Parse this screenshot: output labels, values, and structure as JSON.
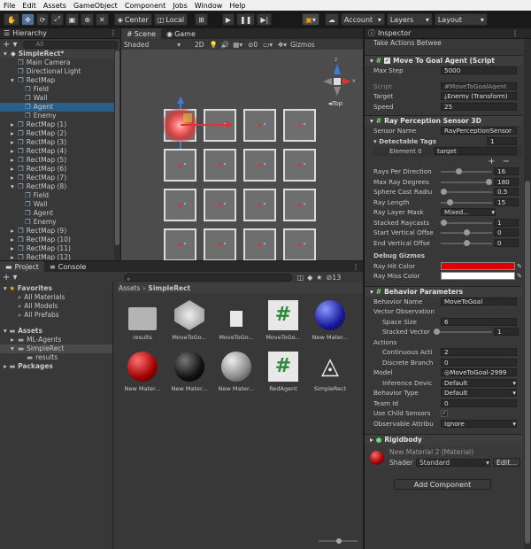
{
  "menu": [
    "File",
    "Edit",
    "Assets",
    "GameObject",
    "Component",
    "Jobs",
    "Window",
    "Help"
  ],
  "toolbar": {
    "center_label": "Center",
    "local_label": "Local",
    "account_label": "Account",
    "layers_label": "Layers",
    "layout_label": "Layout"
  },
  "hierarchy": {
    "tab": "Hierarchy",
    "search_placeholder": "All",
    "items": [
      {
        "label": "SimpleRect*",
        "indent": 0,
        "bold": true
      },
      {
        "label": "Main Camera",
        "indent": 1
      },
      {
        "label": "Directional Light",
        "indent": 1
      },
      {
        "label": "RectMap",
        "indent": 1
      },
      {
        "label": "Field",
        "indent": 2
      },
      {
        "label": "Wall",
        "indent": 2
      },
      {
        "label": "Agent",
        "indent": 2,
        "selected": true
      },
      {
        "label": "Enemy",
        "indent": 2
      },
      {
        "label": "RectMap (1)",
        "indent": 1
      },
      {
        "label": "RectMap (2)",
        "indent": 1
      },
      {
        "label": "RectMap (3)",
        "indent": 1
      },
      {
        "label": "RectMap (4)",
        "indent": 1
      },
      {
        "label": "RectMap (5)",
        "indent": 1
      },
      {
        "label": "RectMap (6)",
        "indent": 1
      },
      {
        "label": "RectMap (7)",
        "indent": 1
      },
      {
        "label": "RectMap (8)",
        "indent": 1
      },
      {
        "label": "Field",
        "indent": 2
      },
      {
        "label": "Wall",
        "indent": 2
      },
      {
        "label": "Agent",
        "indent": 2
      },
      {
        "label": "Enemy",
        "indent": 2
      },
      {
        "label": "RectMap (9)",
        "indent": 1
      },
      {
        "label": "RectMap (10)",
        "indent": 1
      },
      {
        "label": "RectMap (11)",
        "indent": 1
      },
      {
        "label": "RectMap (12)",
        "indent": 1
      }
    ]
  },
  "scene": {
    "tab_scene": "Scene",
    "tab_game": "Game",
    "shading": "Shaded",
    "mode_2d": "2D",
    "gizmos": "Gizmos",
    "gizmo_label": "Top",
    "axis_x": "x",
    "axis_z": "z"
  },
  "project": {
    "tab_project": "Project",
    "tab_console": "Console",
    "hidden_count": "13",
    "breadcrumb_root": "Assets",
    "breadcrumb_leaf": "SimpleRect",
    "favorites_label": "Favorites",
    "favorites": [
      "All Materials",
      "All Models",
      "All Prefabs"
    ],
    "assets_label": "Assets",
    "folders": [
      "ML-Agents",
      "SimpleRect",
      "results"
    ],
    "packages_label": "Packages",
    "assets": [
      {
        "name": "results",
        "kind": "folder"
      },
      {
        "name": "MoveToGo...",
        "kind": "mesh"
      },
      {
        "name": "MoveToGo...",
        "kind": "file"
      },
      {
        "name": "MoveToGo...",
        "kind": "script"
      },
      {
        "name": "New Mater...",
        "kind": "blue"
      },
      {
        "name": "New Mater...",
        "kind": "red"
      },
      {
        "name": "New Mater...",
        "kind": "black"
      },
      {
        "name": "New Mater...",
        "kind": "gray"
      },
      {
        "name": "RedAgent",
        "kind": "script"
      },
      {
        "name": "SimpleRect",
        "kind": "unity"
      }
    ]
  },
  "inspector": {
    "tab": "Inspector",
    "top_cut": "Take Actions Betwee",
    "move_to_goal": {
      "title": "Move To Goal Agent (Script",
      "max_step_label": "Max Step",
      "max_step": "5000",
      "script_label": "Script",
      "script": "MoveToGoalAgent",
      "target_label": "Target",
      "target": "Enemy (Transform)",
      "speed_label": "Speed",
      "speed": "25"
    },
    "ray": {
      "title": "Ray Perception Sensor 3D",
      "sensor_name_label": "Sensor Name",
      "sensor_name": "RayPerceptionSensor",
      "tags_label": "Detectable Tags",
      "tags_count": "1",
      "element0_label": "Element 0",
      "element0": "target",
      "rays_per_dir_label": "Rays Per Direction",
      "rays_per_dir": "16",
      "rays_per_dir_frac": 0.34,
      "max_ray_deg_label": "Max Ray Degrees",
      "max_ray_deg": "180",
      "max_ray_deg_frac": 1.0,
      "sphere_radius_label": "Sphere Cast Radiu",
      "sphere_radius": "0.5",
      "sphere_radius_frac": 0.0,
      "ray_length_label": "Ray Length",
      "ray_length": "15",
      "ray_length_frac": 0.14,
      "layer_mask_label": "Ray Layer Mask",
      "layer_mask": "Mixed...",
      "stacked_label": "Stacked Raycasts",
      "stacked": "1",
      "stacked_frac": 0.0,
      "start_off_label": "Start Vertical Offse",
      "start_off": "0",
      "start_off_frac": 0.5,
      "end_off_label": "End Vertical Offse",
      "end_off": "0",
      "end_off_frac": 0.5,
      "debug_label": "Debug Gizmos",
      "hit_color_label": "Ray Hit Color",
      "hit_color": "#e00000",
      "miss_color_label": "Ray Miss Color",
      "miss_color": "#ffffff"
    },
    "behavior": {
      "title": "Behavior Parameters",
      "name_label": "Behavior Name",
      "name": "MoveToGoal",
      "vector_obs_label": "Vector Observation",
      "space_size_label": "Space Size",
      "space_size": "6",
      "stacked_vec_label": "Stacked Vector",
      "stacked_vec": "1",
      "stacked_vec_frac": 0.0,
      "actions_label": "Actions",
      "cont_label": "Continuous Acti",
      "cont": "2",
      "disc_label": "Discrete Branch",
      "disc": "0",
      "model_label": "Model",
      "model": "MoveToGoal-2999",
      "inference_label": "Inference Devic",
      "inference": "Default",
      "btype_label": "Behavior Type",
      "btype": "Default",
      "team_label": "Team Id",
      "team": "0",
      "child_label": "Use Child Sensors",
      "obs_label": "Observable Attribu",
      "obs": "Ignore"
    },
    "rigidbody_title": "Rigidbody",
    "material_title": "New Material 2 (Material)",
    "shader_label": "Shader",
    "shader": "Standard",
    "edit_label": "Edit...",
    "add_component": "Add Component"
  }
}
